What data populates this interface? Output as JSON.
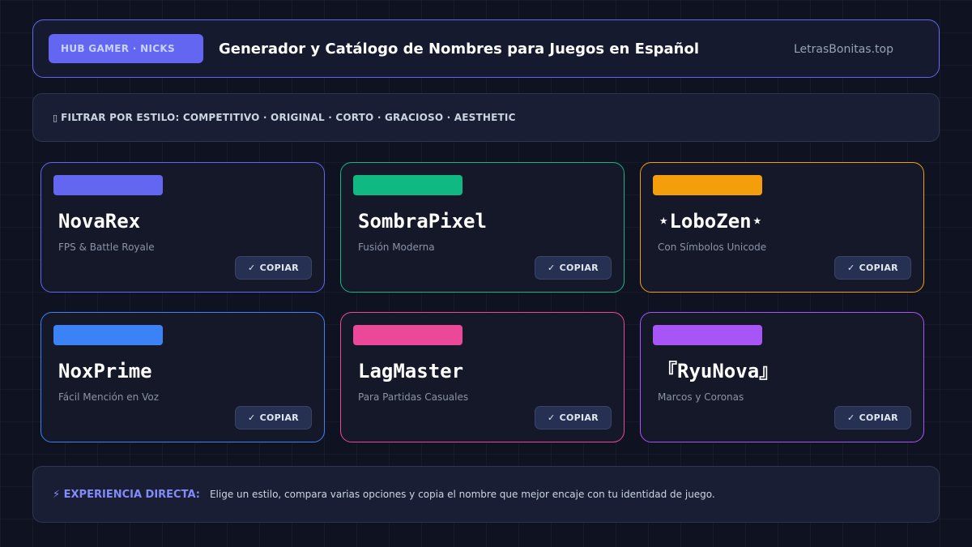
{
  "header": {
    "badge": "HUB GAMER · NICKS",
    "title": "Generador y Catálogo de Nombres para Juegos en Español",
    "site": "LetrasBonitas.top",
    "accent": "#6366f1"
  },
  "filter": {
    "icon": "filter-icon",
    "text": "FILTRAR POR ESTILO: COMPETITIVO · ORIGINAL · CORTO · GRACIOSO · AESTHETIC"
  },
  "cards": [
    {
      "nick": "NovaRex",
      "subtitle": "FPS & Battle Royale",
      "color": "#6366f1",
      "copy_label": "COPIAR"
    },
    {
      "nick": "SombraPixel",
      "subtitle": "Fusión Moderna",
      "color": "#10b981",
      "copy_label": "COPIAR"
    },
    {
      "nick": "⋆LoboZen⋆",
      "subtitle": "Con Símbolos Unicode",
      "color": "#f59e0b",
      "copy_label": "COPIAR"
    },
    {
      "nick": "NoxPrime",
      "subtitle": "Fácil Mención en Voz",
      "color": "#3b82f6",
      "copy_label": "COPIAR"
    },
    {
      "nick": "LagMaster",
      "subtitle": "Para Partidas Casuales",
      "color": "#ec4899",
      "copy_label": "COPIAR"
    },
    {
      "nick": "『RyuNova』",
      "subtitle": "Marcos y Coronas",
      "color": "#a855f7",
      "copy_label": "COPIAR"
    }
  ],
  "footer": {
    "lead": "⚡ EXPERIENCIA DIRECTA:",
    "text": "Elige un estilo, compara varias opciones y copia el nombre que mejor encaje con tu identidad de juego."
  }
}
